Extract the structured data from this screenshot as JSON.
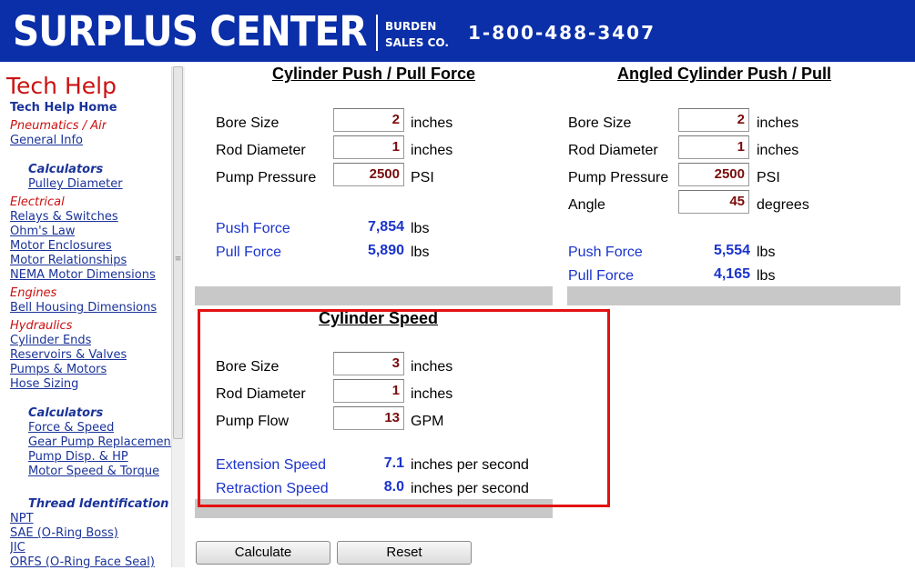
{
  "banner": {
    "logo_main": "SURPLUS CENTER",
    "logo_sub_1": "BURDEN",
    "logo_sub_2": "SALES CO.",
    "phone": "1-800-488-3407",
    "bg_color": "#0b2fa8"
  },
  "sidebar": {
    "title": "Tech Help",
    "home": "Tech Help Home",
    "items": [
      {
        "type": "cat",
        "label": "Pneumatics / Air"
      },
      {
        "type": "link",
        "label": "General Info"
      },
      {
        "type": "head",
        "label": "Calculators"
      },
      {
        "type": "link",
        "label": "Pulley Diameter"
      },
      {
        "type": "cat",
        "label": "Electrical"
      },
      {
        "type": "link",
        "label": "Relays & Switches"
      },
      {
        "type": "link",
        "label": "Ohm's Law"
      },
      {
        "type": "link",
        "label": "Motor Enclosures"
      },
      {
        "type": "link",
        "label": "Motor Relationships"
      },
      {
        "type": "link",
        "label": "NEMA Motor Dimensions"
      },
      {
        "type": "cat",
        "label": "Engines"
      },
      {
        "type": "link",
        "label": "Bell Housing Dimensions"
      },
      {
        "type": "cat",
        "label": "Hydraulics"
      },
      {
        "type": "link",
        "label": "Cylinder Ends"
      },
      {
        "type": "link",
        "label": "Reservoirs & Valves"
      },
      {
        "type": "link",
        "label": "Pumps & Motors"
      },
      {
        "type": "link",
        "label": "Hose Sizing"
      },
      {
        "type": "head",
        "label": "Calculators"
      },
      {
        "type": "link",
        "label": "Force & Speed"
      },
      {
        "type": "link",
        "label": "Gear Pump Replacement"
      },
      {
        "type": "link",
        "label": "Pump Disp. & HP"
      },
      {
        "type": "link",
        "label": "Motor Speed & Torque"
      },
      {
        "type": "head",
        "label": "Thread Identification"
      },
      {
        "type": "link",
        "label": "NPT"
      },
      {
        "type": "link",
        "label": "SAE (O-Ring Boss)"
      },
      {
        "type": "link",
        "label": "JIC"
      },
      {
        "type": "link",
        "label": "ORFS (O-Ring Face Seal)"
      }
    ]
  },
  "push_pull": {
    "title": "Cylinder Push / Pull Force",
    "bore_label": "Bore Size",
    "bore_value": "2",
    "bore_unit": "inches",
    "rod_label": "Rod Diameter",
    "rod_value": "1",
    "rod_unit": "inches",
    "pressure_label": "Pump Pressure",
    "pressure_value": "2500",
    "pressure_unit": "PSI",
    "push_label": "Push Force",
    "push_value": "7,854",
    "push_unit": "lbs",
    "pull_label": "Pull Force",
    "pull_value": "5,890",
    "pull_unit": "lbs"
  },
  "angled": {
    "title": "Angled Cylinder Push / Pull",
    "bore_label": "Bore Size",
    "bore_value": "2",
    "bore_unit": "inches",
    "rod_label": "Rod Diameter",
    "rod_value": "1",
    "rod_unit": "inches",
    "pressure_label": "Pump Pressure",
    "pressure_value": "2500",
    "pressure_unit": "PSI",
    "angle_label": "Angle",
    "angle_value": "45",
    "angle_unit": "degrees",
    "push_label": "Push Force",
    "push_value": "5,554",
    "push_unit": "lbs",
    "pull_label": "Pull Force",
    "pull_value": "4,165",
    "pull_unit": "lbs"
  },
  "speed": {
    "title": "Cylinder Speed",
    "bore_label": "Bore Size",
    "bore_value": "3",
    "bore_unit": "inches",
    "rod_label": "Rod Diameter",
    "rod_value": "1",
    "rod_unit": "inches",
    "flow_label": "Pump Flow",
    "flow_value": "13",
    "flow_unit": "GPM",
    "ext_label": "Extension Speed",
    "ext_value": "7.1",
    "ext_unit": "inches per second",
    "ret_label": "Retraction Speed",
    "ret_value": "8.0",
    "ret_unit": "inches per second"
  },
  "buttons": {
    "calculate": "Calculate",
    "reset": "Reset"
  },
  "colors": {
    "input_text": "#7a0c0c",
    "result_text": "#1a33cc",
    "highlight": "#e31111"
  }
}
